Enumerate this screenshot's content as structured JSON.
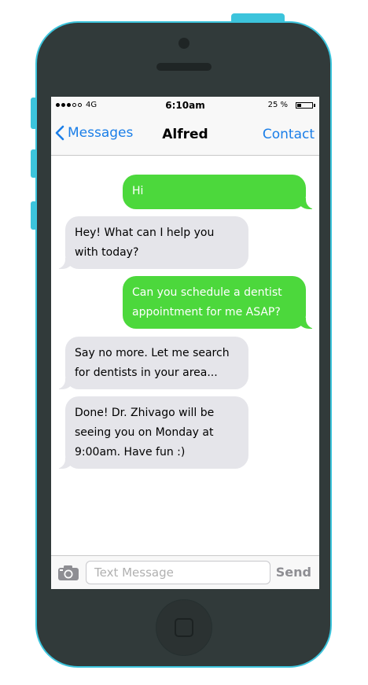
{
  "status_bar": {
    "carrier": "4G",
    "time": "6:10am",
    "battery_percent": "25 %",
    "battery_level": 0.25,
    "signal_bars_filled": 3,
    "signal_bars_total": 5
  },
  "nav": {
    "back_label": "Messages",
    "title": "Alfred",
    "contact_label": "Contact"
  },
  "messages": [
    {
      "direction": "out",
      "text": "Hi"
    },
    {
      "direction": "in",
      "text": "Hey! What can I help you with today?"
    },
    {
      "direction": "out",
      "text": "Can you schedule a dentist appointment for me ASAP?"
    },
    {
      "direction": "in",
      "text": "Say no more. Let me search for dentists in your area..."
    },
    {
      "direction": "in",
      "text": "Done! Dr. Zhivago will be seeing you on Monday at 9:00am. Have fun :)"
    }
  ],
  "input": {
    "placeholder": "Text Message",
    "value": "",
    "send_label": "Send"
  },
  "icons": {
    "back": "chevron-left-icon",
    "camera": "camera-icon"
  },
  "colors": {
    "accent_blue": "#1a7ee8",
    "outgoing_bubble": "#4cd83c",
    "incoming_bubble": "#e5e5ea",
    "phone_body": "#313a3a",
    "phone_trim": "#3cc4dc"
  }
}
